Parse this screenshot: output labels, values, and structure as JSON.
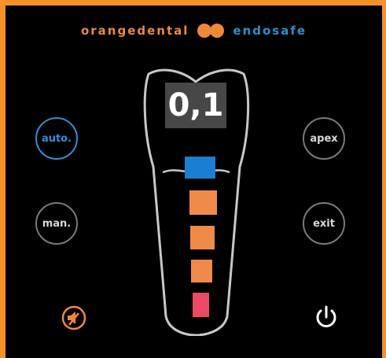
{
  "brand": {
    "left": "orangedental",
    "right": "endosafe"
  },
  "display": {
    "value": "0,1"
  },
  "buttons": {
    "auto": "auto.",
    "manual": "man.",
    "apex": "apex",
    "exit": "exit"
  },
  "meter": {
    "segments": [
      {
        "level": "apex",
        "color": "#1b7fd1"
      },
      {
        "level": "1",
        "color": "#f08a4b"
      },
      {
        "level": "2",
        "color": "#f08a4b"
      },
      {
        "level": "3",
        "color": "#f08a4b"
      },
      {
        "level": "4",
        "color": "#ec4964"
      }
    ]
  },
  "colors": {
    "frame": "#f2922b",
    "accent_blue": "#2b8ed6",
    "accent_orange": "#f0883a"
  },
  "icons": {
    "brand": "link-logo-icon",
    "mute": "speaker-muted-icon",
    "power": "power-icon"
  }
}
